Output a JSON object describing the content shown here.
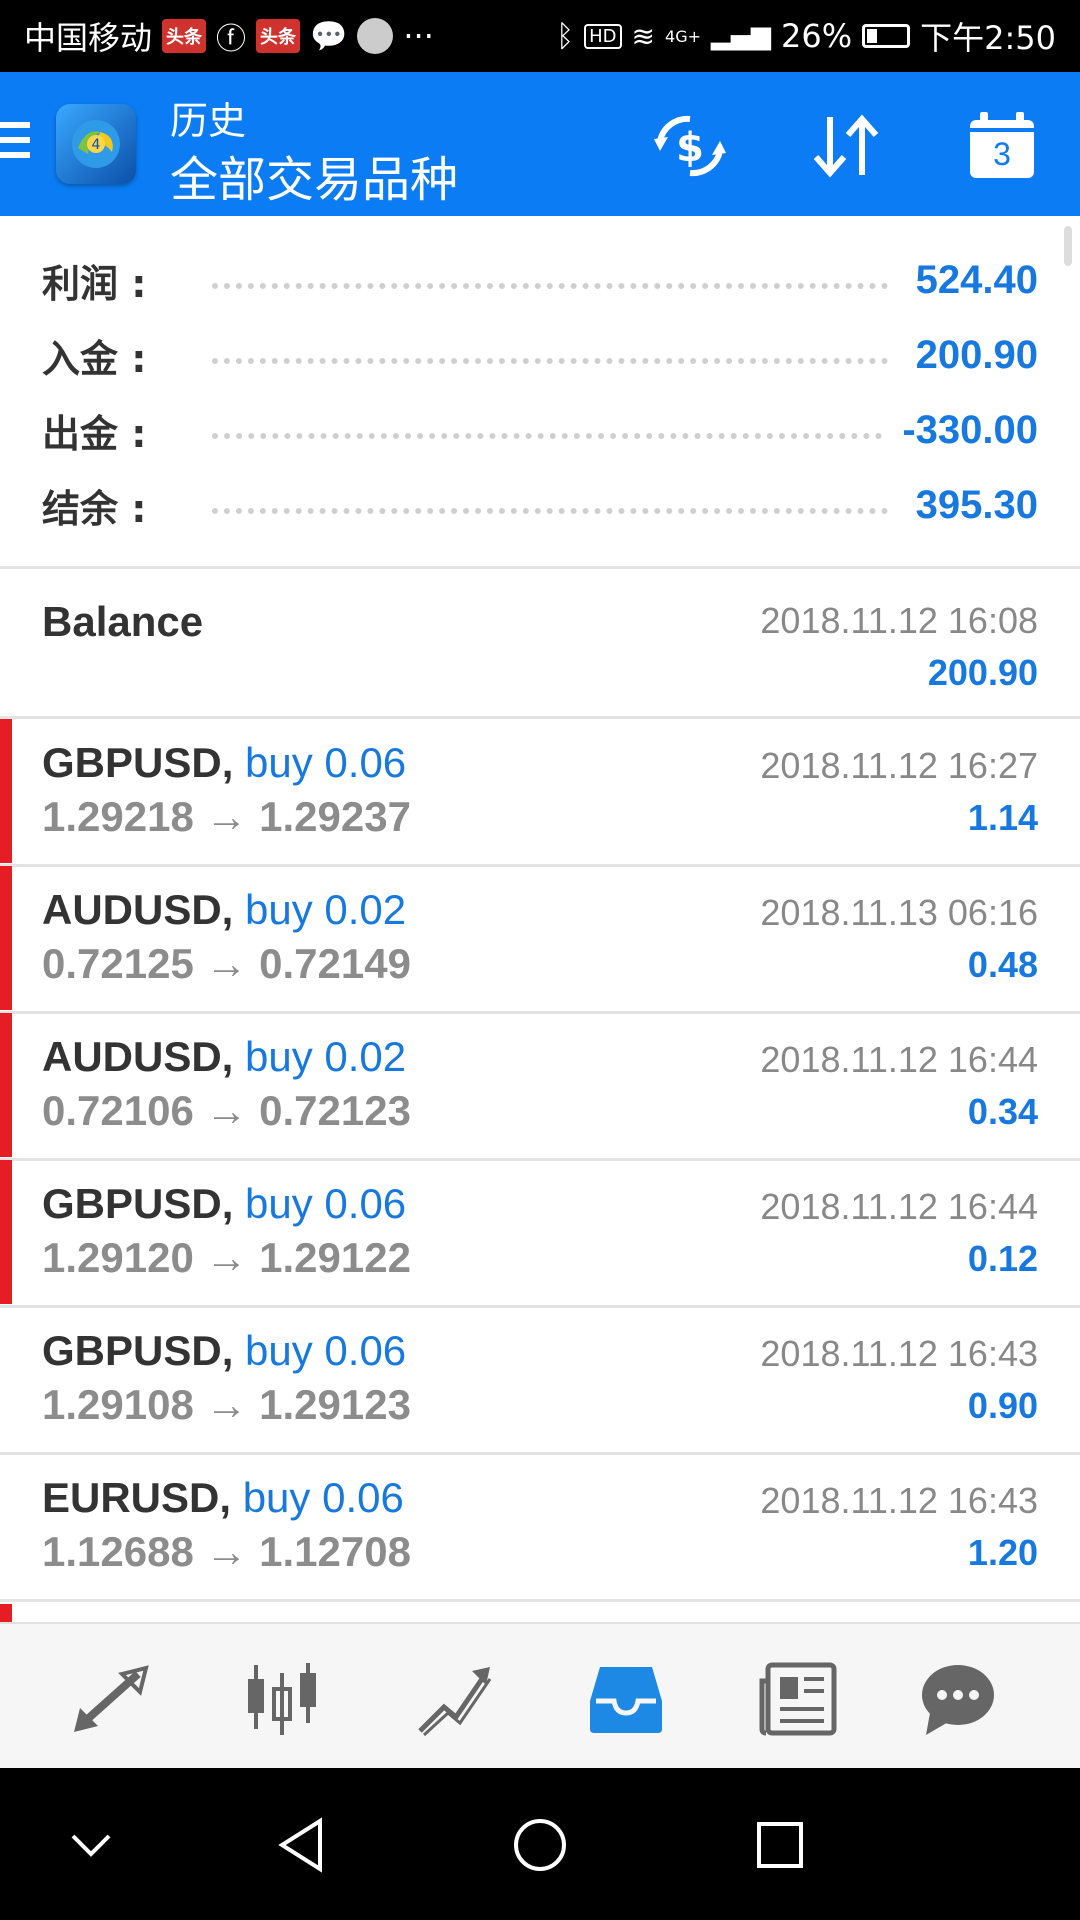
{
  "status_bar": {
    "carrier": "中国移动",
    "badge1": "头条",
    "badge2": "头条",
    "more": "···",
    "network": "4G+",
    "battery": "26%",
    "time": "下午2:50"
  },
  "app_bar": {
    "section": "历史",
    "filter": "全部交易品种",
    "calendar_day": "3"
  },
  "summary": [
    {
      "label": "利润 :",
      "value": "524.40"
    },
    {
      "label": "入金 :",
      "value": "200.90"
    },
    {
      "label": "出金 :",
      "value": "-330.00"
    },
    {
      "label": "结余 :",
      "value": "395.30"
    }
  ],
  "balance": {
    "title": "Balance",
    "date": "2018.11.12 16:08",
    "value": "200.90"
  },
  "trades": [
    {
      "symbol": "GBPUSD,",
      "action": "buy 0.06",
      "prices": "1.29218 → 1.29237",
      "date": "2018.11.12 16:27",
      "profit": "1.14"
    },
    {
      "symbol": "AUDUSD,",
      "action": "buy 0.02",
      "prices": "0.72125 → 0.72149",
      "date": "2018.11.13 06:16",
      "profit": "0.48"
    },
    {
      "symbol": "AUDUSD,",
      "action": "buy 0.02",
      "prices": "0.72106 → 0.72123",
      "date": "2018.11.12 16:44",
      "profit": "0.34"
    },
    {
      "symbol": "GBPUSD,",
      "action": "buy 0.06",
      "prices": "1.29120 → 1.29122",
      "date": "2018.11.12 16:44",
      "profit": "0.12"
    },
    {
      "symbol": "GBPUSD,",
      "action": "buy 0.06",
      "prices": "1.29108 → 1.29123",
      "date": "2018.11.12 16:43",
      "profit": "0.90"
    },
    {
      "symbol": "EURUSD,",
      "action": "buy 0.06",
      "prices": "1.12688 → 1.12708",
      "date": "2018.11.12 16:43",
      "profit": "1.20"
    }
  ],
  "bottom_nav": [
    {
      "name": "quotes-icon"
    },
    {
      "name": "chart-candles-icon"
    },
    {
      "name": "trade-icon"
    },
    {
      "name": "history-inbox-icon",
      "active": true
    },
    {
      "name": "news-icon"
    },
    {
      "name": "chat-icon"
    }
  ],
  "colors": {
    "accent": "#0b7cf3",
    "value_blue": "#1778e0",
    "trade_bar": "#e51e25"
  }
}
